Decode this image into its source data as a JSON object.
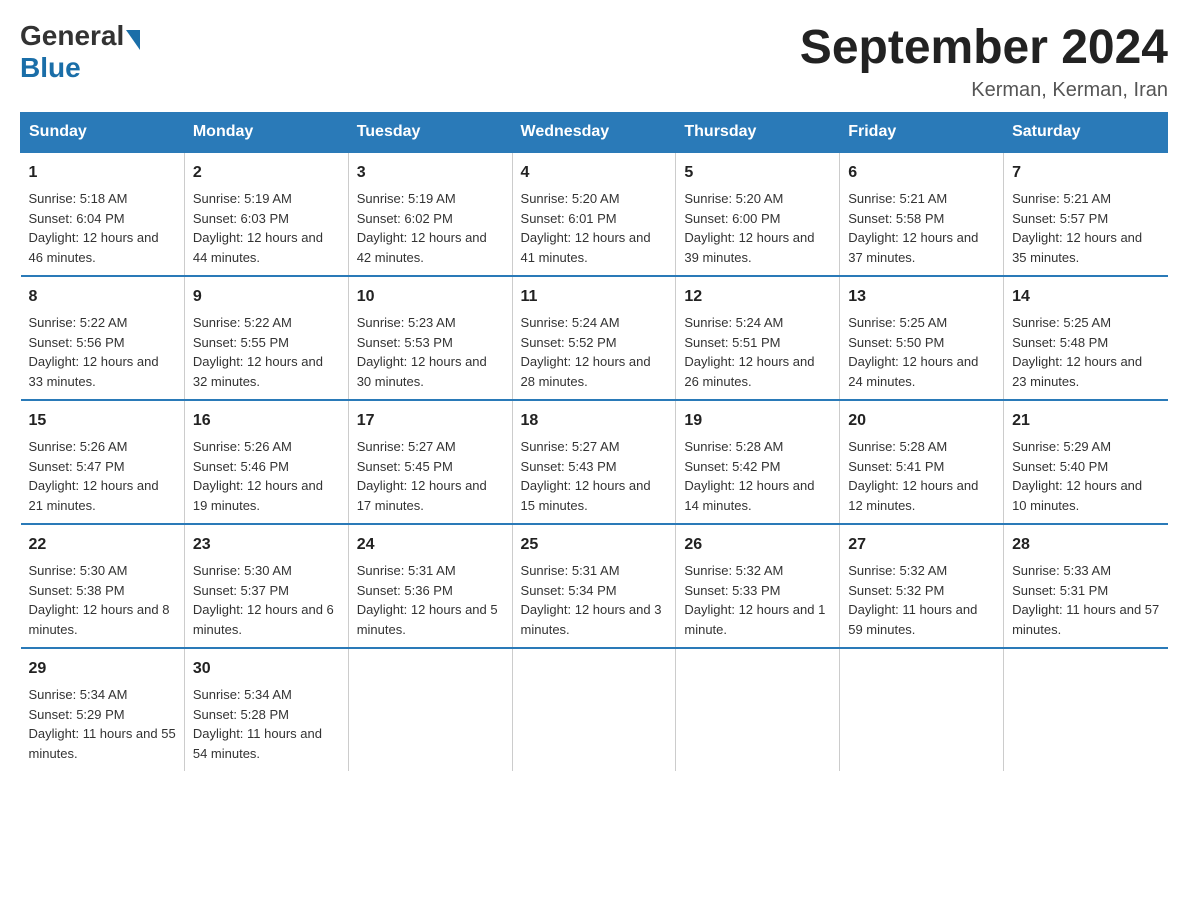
{
  "logo": {
    "general": "General",
    "blue": "Blue"
  },
  "title": "September 2024",
  "location": "Kerman, Kerman, Iran",
  "days_header": [
    "Sunday",
    "Monday",
    "Tuesday",
    "Wednesday",
    "Thursday",
    "Friday",
    "Saturday"
  ],
  "weeks": [
    [
      {
        "day": "1",
        "sunrise": "Sunrise: 5:18 AM",
        "sunset": "Sunset: 6:04 PM",
        "daylight": "Daylight: 12 hours and 46 minutes."
      },
      {
        "day": "2",
        "sunrise": "Sunrise: 5:19 AM",
        "sunset": "Sunset: 6:03 PM",
        "daylight": "Daylight: 12 hours and 44 minutes."
      },
      {
        "day": "3",
        "sunrise": "Sunrise: 5:19 AM",
        "sunset": "Sunset: 6:02 PM",
        "daylight": "Daylight: 12 hours and 42 minutes."
      },
      {
        "day": "4",
        "sunrise": "Sunrise: 5:20 AM",
        "sunset": "Sunset: 6:01 PM",
        "daylight": "Daylight: 12 hours and 41 minutes."
      },
      {
        "day": "5",
        "sunrise": "Sunrise: 5:20 AM",
        "sunset": "Sunset: 6:00 PM",
        "daylight": "Daylight: 12 hours and 39 minutes."
      },
      {
        "day": "6",
        "sunrise": "Sunrise: 5:21 AM",
        "sunset": "Sunset: 5:58 PM",
        "daylight": "Daylight: 12 hours and 37 minutes."
      },
      {
        "day": "7",
        "sunrise": "Sunrise: 5:21 AM",
        "sunset": "Sunset: 5:57 PM",
        "daylight": "Daylight: 12 hours and 35 minutes."
      }
    ],
    [
      {
        "day": "8",
        "sunrise": "Sunrise: 5:22 AM",
        "sunset": "Sunset: 5:56 PM",
        "daylight": "Daylight: 12 hours and 33 minutes."
      },
      {
        "day": "9",
        "sunrise": "Sunrise: 5:22 AM",
        "sunset": "Sunset: 5:55 PM",
        "daylight": "Daylight: 12 hours and 32 minutes."
      },
      {
        "day": "10",
        "sunrise": "Sunrise: 5:23 AM",
        "sunset": "Sunset: 5:53 PM",
        "daylight": "Daylight: 12 hours and 30 minutes."
      },
      {
        "day": "11",
        "sunrise": "Sunrise: 5:24 AM",
        "sunset": "Sunset: 5:52 PM",
        "daylight": "Daylight: 12 hours and 28 minutes."
      },
      {
        "day": "12",
        "sunrise": "Sunrise: 5:24 AM",
        "sunset": "Sunset: 5:51 PM",
        "daylight": "Daylight: 12 hours and 26 minutes."
      },
      {
        "day": "13",
        "sunrise": "Sunrise: 5:25 AM",
        "sunset": "Sunset: 5:50 PM",
        "daylight": "Daylight: 12 hours and 24 minutes."
      },
      {
        "day": "14",
        "sunrise": "Sunrise: 5:25 AM",
        "sunset": "Sunset: 5:48 PM",
        "daylight": "Daylight: 12 hours and 23 minutes."
      }
    ],
    [
      {
        "day": "15",
        "sunrise": "Sunrise: 5:26 AM",
        "sunset": "Sunset: 5:47 PM",
        "daylight": "Daylight: 12 hours and 21 minutes."
      },
      {
        "day": "16",
        "sunrise": "Sunrise: 5:26 AM",
        "sunset": "Sunset: 5:46 PM",
        "daylight": "Daylight: 12 hours and 19 minutes."
      },
      {
        "day": "17",
        "sunrise": "Sunrise: 5:27 AM",
        "sunset": "Sunset: 5:45 PM",
        "daylight": "Daylight: 12 hours and 17 minutes."
      },
      {
        "day": "18",
        "sunrise": "Sunrise: 5:27 AM",
        "sunset": "Sunset: 5:43 PM",
        "daylight": "Daylight: 12 hours and 15 minutes."
      },
      {
        "day": "19",
        "sunrise": "Sunrise: 5:28 AM",
        "sunset": "Sunset: 5:42 PM",
        "daylight": "Daylight: 12 hours and 14 minutes."
      },
      {
        "day": "20",
        "sunrise": "Sunrise: 5:28 AM",
        "sunset": "Sunset: 5:41 PM",
        "daylight": "Daylight: 12 hours and 12 minutes."
      },
      {
        "day": "21",
        "sunrise": "Sunrise: 5:29 AM",
        "sunset": "Sunset: 5:40 PM",
        "daylight": "Daylight: 12 hours and 10 minutes."
      }
    ],
    [
      {
        "day": "22",
        "sunrise": "Sunrise: 5:30 AM",
        "sunset": "Sunset: 5:38 PM",
        "daylight": "Daylight: 12 hours and 8 minutes."
      },
      {
        "day": "23",
        "sunrise": "Sunrise: 5:30 AM",
        "sunset": "Sunset: 5:37 PM",
        "daylight": "Daylight: 12 hours and 6 minutes."
      },
      {
        "day": "24",
        "sunrise": "Sunrise: 5:31 AM",
        "sunset": "Sunset: 5:36 PM",
        "daylight": "Daylight: 12 hours and 5 minutes."
      },
      {
        "day": "25",
        "sunrise": "Sunrise: 5:31 AM",
        "sunset": "Sunset: 5:34 PM",
        "daylight": "Daylight: 12 hours and 3 minutes."
      },
      {
        "day": "26",
        "sunrise": "Sunrise: 5:32 AM",
        "sunset": "Sunset: 5:33 PM",
        "daylight": "Daylight: 12 hours and 1 minute."
      },
      {
        "day": "27",
        "sunrise": "Sunrise: 5:32 AM",
        "sunset": "Sunset: 5:32 PM",
        "daylight": "Daylight: 11 hours and 59 minutes."
      },
      {
        "day": "28",
        "sunrise": "Sunrise: 5:33 AM",
        "sunset": "Sunset: 5:31 PM",
        "daylight": "Daylight: 11 hours and 57 minutes."
      }
    ],
    [
      {
        "day": "29",
        "sunrise": "Sunrise: 5:34 AM",
        "sunset": "Sunset: 5:29 PM",
        "daylight": "Daylight: 11 hours and 55 minutes."
      },
      {
        "day": "30",
        "sunrise": "Sunrise: 5:34 AM",
        "sunset": "Sunset: 5:28 PM",
        "daylight": "Daylight: 11 hours and 54 minutes."
      },
      null,
      null,
      null,
      null,
      null
    ]
  ]
}
